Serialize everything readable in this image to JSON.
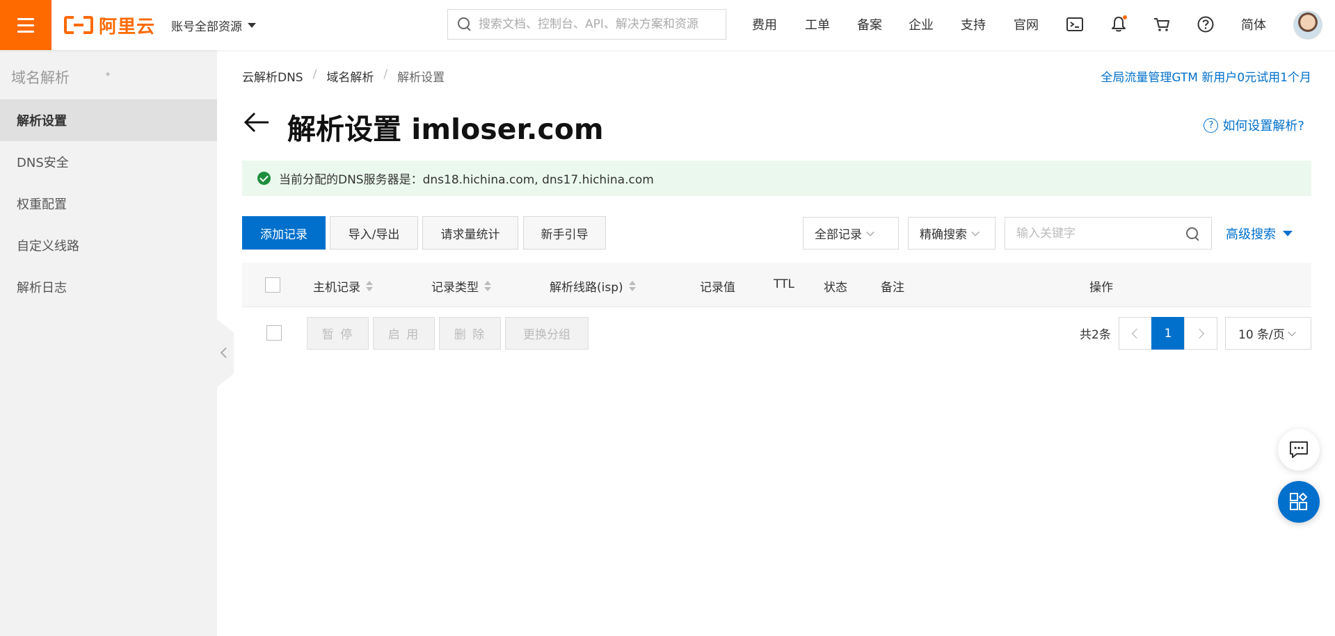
{
  "header": {
    "logo_text": "阿里云",
    "account_label": "账号全部资源",
    "search_placeholder": "搜索文档、控制台、API、解决方案和资源",
    "nav": [
      "费用",
      "工单",
      "备案",
      "企业",
      "支持",
      "官网"
    ],
    "language": "简体",
    "icons": [
      "terminal-icon",
      "bell-icon",
      "cart-icon",
      "help-icon"
    ],
    "notification_dot_color": "#ff6a00"
  },
  "sidebar": {
    "title": "域名解析",
    "items": [
      {
        "label": "解析设置",
        "active": true
      },
      {
        "label": "DNS安全"
      },
      {
        "label": "权重配置"
      },
      {
        "label": "自定义线路"
      },
      {
        "label": "解析日志"
      }
    ]
  },
  "breadcrumb": [
    "云解析DNS",
    "域名解析",
    "解析设置"
  ],
  "promo_link": "全局流量管理GTM 新用户0元试用1个月",
  "page_title": "解析设置 imloser.com",
  "help_link": "如何设置解析?",
  "notice": "当前分配的DNS服务器是：dns18.hichina.com, dns17.hichina.com",
  "toolbar": {
    "add_record": "添加记录",
    "import_export": "导入/导出",
    "request_stats": "请求量统计",
    "guide": "新手引导",
    "filter_all": "全部记录",
    "exact_search": "精确搜索",
    "keyword_placeholder": "输入关键字",
    "advanced_search": "高级搜索"
  },
  "table": {
    "columns": [
      "主机记录",
      "记录类型",
      "解析线路(isp)",
      "记录值",
      "TTL",
      "状态",
      "备注",
      "操作"
    ]
  },
  "batch": {
    "pause": "暂 停",
    "enable": "启 用",
    "delete": "删 除",
    "change_group": "更换分组"
  },
  "pagination": {
    "total": "共2条",
    "current_page": "1",
    "page_size": "10 条/页"
  },
  "colors": {
    "brand": "#ff6a00",
    "primary": "#0070cc",
    "success": "#1e8e3e",
    "notice_bg": "#ebf8ee"
  }
}
